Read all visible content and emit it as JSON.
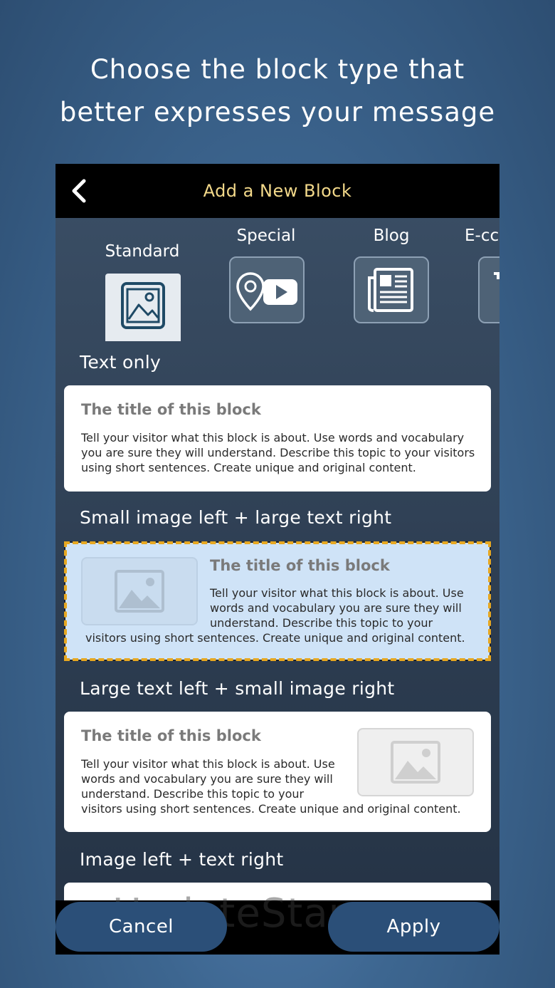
{
  "headline": {
    "line1": "Choose the block type that",
    "line2": "better expresses your message"
  },
  "topbar": {
    "title": "Add a New Block",
    "back_icon": "chevron-left-icon"
  },
  "categories": [
    {
      "label": "Standard",
      "icon": "image-frame-icon",
      "active": true
    },
    {
      "label": "Special",
      "icon": "location-video-icon",
      "active": false
    },
    {
      "label": "Blog",
      "icon": "newspaper-icon",
      "active": false
    },
    {
      "label": "E-cc",
      "icon": "tag-icon",
      "active": false
    }
  ],
  "blocks": [
    {
      "label": "Text only",
      "title": "The title of this block",
      "body": "Tell your visitor what this block is about. Use words and vocabulary you are sure they will understand. Describe this topic to your visitors using short sentences. Create unique and original content."
    },
    {
      "label": "Small image left + large text right",
      "title": "The title of this block",
      "body_lines": [
        "Tell your visitor what this block is about. Use",
        "words and vocabulary you are sure they will",
        "understand. Describe this topic to your",
        "visitors using short sentences. Create unique and original content."
      ],
      "selected": true
    },
    {
      "label": "Large text left + small image right",
      "title": "The title of this block",
      "body_lines": [
        "Tell your visitor what this block is about. Use",
        "words and vocabulary you are sure they will",
        "understand. Describe this topic to your",
        "visitors using short sentences. Create unique and original content."
      ]
    },
    {
      "label": "Image left + text right"
    }
  ],
  "actions": {
    "cancel": "Cancel",
    "apply": "Apply"
  },
  "watermark": "UpdateStar.com",
  "colors": {
    "accent_title": "#f3d98a",
    "selected_bg": "#cfe3f7",
    "selected_outline": "#e8a820",
    "button_bg": "#2b4f78"
  }
}
